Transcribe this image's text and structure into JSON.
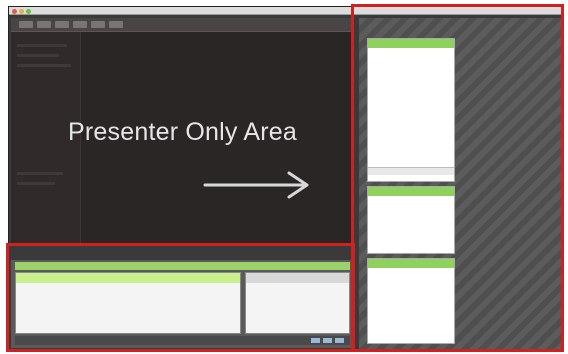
{
  "presenter": {
    "label": "Presenter Only Area",
    "arrow_icon": "right-arrow-icon"
  },
  "bottom_panel": {
    "title": "",
    "subbar": "",
    "chat_line": "",
    "notes_line": ""
  },
  "right_panels": [
    {
      "header": ""
    },
    {
      "header": ""
    },
    {
      "header": ""
    }
  ],
  "colors": {
    "highlight": "#d12020",
    "panel_header": "#8ed15c",
    "presenter_bg": "#2b2626"
  }
}
